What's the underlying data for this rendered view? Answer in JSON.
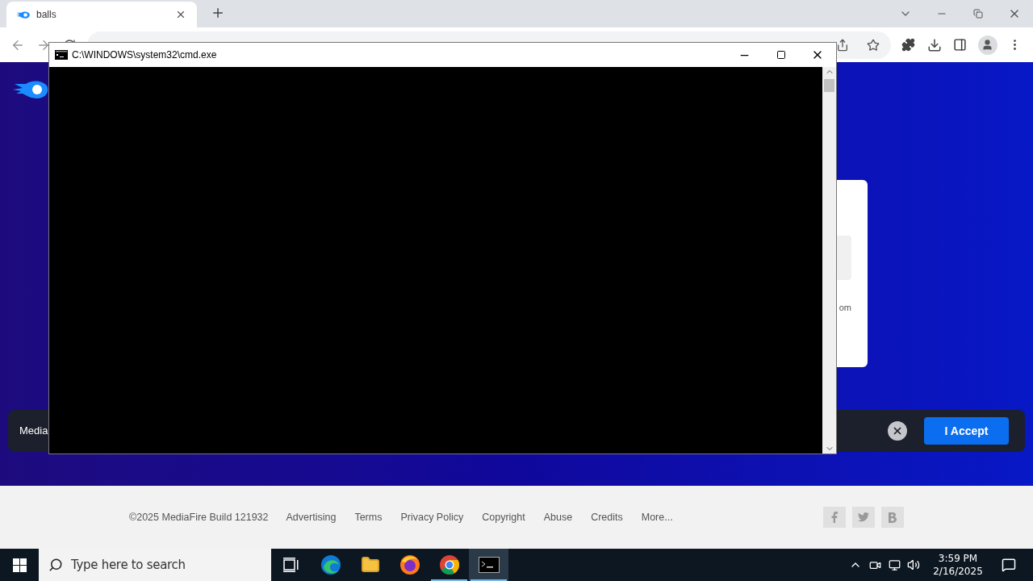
{
  "browser": {
    "tabs": [
      {
        "title": "balls",
        "selected": true
      }
    ]
  },
  "page": {
    "card_text": "om",
    "cookie_banner": {
      "text": "Media",
      "accept_button": "I Accept"
    },
    "footer": {
      "copyright": "©2025 MediaFire Build 121932",
      "links": [
        "Advertising",
        "Terms",
        "Privacy Policy",
        "Copyright",
        "Abuse",
        "Credits",
        "More..."
      ]
    }
  },
  "cmd_window": {
    "title": "C:\\WINDOWS\\system32\\cmd.exe"
  },
  "taskbar": {
    "search_placeholder": "Type here to search",
    "apps": [
      {
        "kind": "task-view",
        "selected": false,
        "running": false
      },
      {
        "kind": "edge",
        "selected": false,
        "running": false
      },
      {
        "kind": "explorer",
        "selected": false,
        "running": false
      },
      {
        "kind": "firefox",
        "selected": false,
        "running": false
      },
      {
        "kind": "chrome",
        "selected": false,
        "running": true
      },
      {
        "kind": "terminal",
        "selected": true,
        "running": true
      }
    ],
    "time": "3:59 PM",
    "date": "2/16/2025"
  }
}
